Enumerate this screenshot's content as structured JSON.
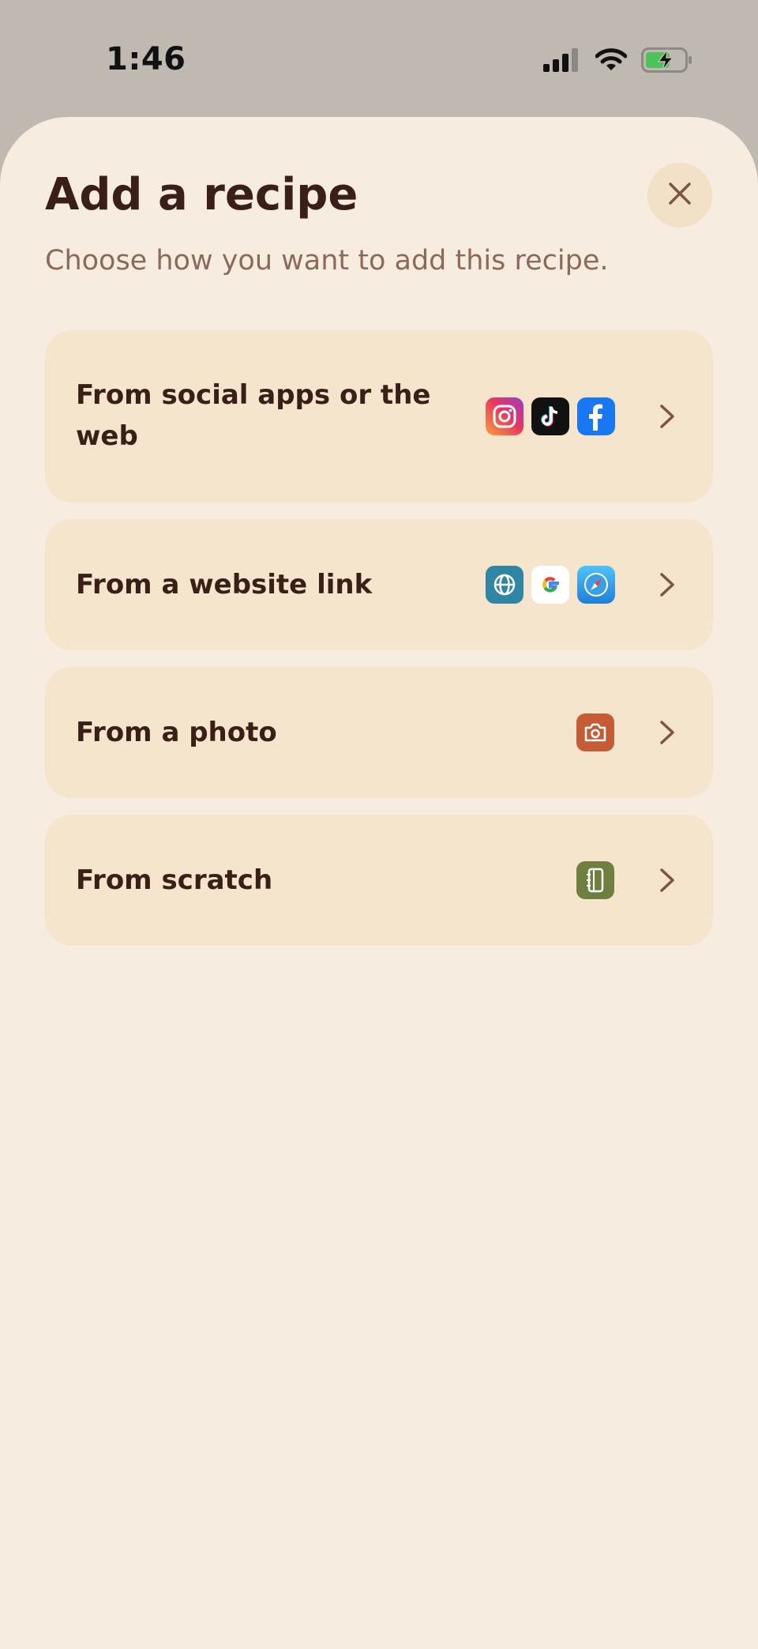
{
  "status_bar": {
    "time": "1:46"
  },
  "sheet": {
    "title": "Add a recipe",
    "subtitle": "Choose how you want to add this recipe."
  },
  "options": [
    {
      "label_line1": "From social apps or the",
      "label_line2": "web",
      "icons": [
        "instagram-icon",
        "tiktok-icon",
        "facebook-icon"
      ]
    },
    {
      "label": "From a website link",
      "icons": [
        "globe-icon",
        "google-icon",
        "safari-icon"
      ]
    },
    {
      "label": "From a photo",
      "icons": [
        "camera-icon"
      ]
    },
    {
      "label": "From scratch",
      "icons": [
        "notebook-icon"
      ]
    }
  ],
  "colors": {
    "sheet_background": "#f6ede0",
    "card_background": "#f4e5cc",
    "title_text": "#3a1f16",
    "subtitle_text": "#8c6a58",
    "photo_accent": "#c65c36",
    "scratch_accent": "#6e7f3f",
    "website_accent": "#2f86a4"
  }
}
